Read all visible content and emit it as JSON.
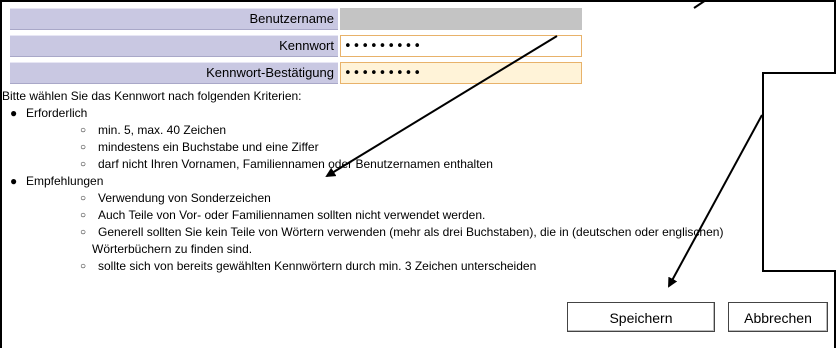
{
  "form": {
    "username_label": "Benutzername",
    "username_value": "",
    "password_label": "Kennwort",
    "password_value": "•••••••••",
    "confirm_label": "Kennwort-Bestätigung",
    "confirm_value": "•••••••••"
  },
  "criteria": {
    "intro": "Bitte wählen Sie das Kennwort nach folgenden Kriterien:",
    "required_heading": "Erforderlich",
    "required_items": [
      "min. 5, max. 40 Zeichen",
      "mindestens ein Buchstabe und eine Ziffer",
      "darf nicht Ihren Vornamen, Familiennamen oder Benutzernamen enthalten"
    ],
    "recommended_heading": "Empfehlungen",
    "recommended_items": [
      "Verwendung von Sonderzeichen",
      "Auch Teile von Vor- oder Familiennamen sollten nicht verwendet werden.",
      "Generell sollten Sie kein Teile von Wörtern verwenden (mehr als drei Buchstaben), die in (deutschen oder englischen)",
      "Wörterbüchern zu finden sind.",
      "sollte sich von bereits gewählten Kennwörtern durch min. 3 Zeichen unterscheiden"
    ]
  },
  "buttons": {
    "save_label": "Speichern",
    "cancel_label": "Abbrechen"
  },
  "colors": {
    "label_background": "#c9c8e2",
    "readonly_background": "#c4c4c4",
    "input_border": "#e8b26a",
    "confirm_input_background": "#fff3d8"
  }
}
